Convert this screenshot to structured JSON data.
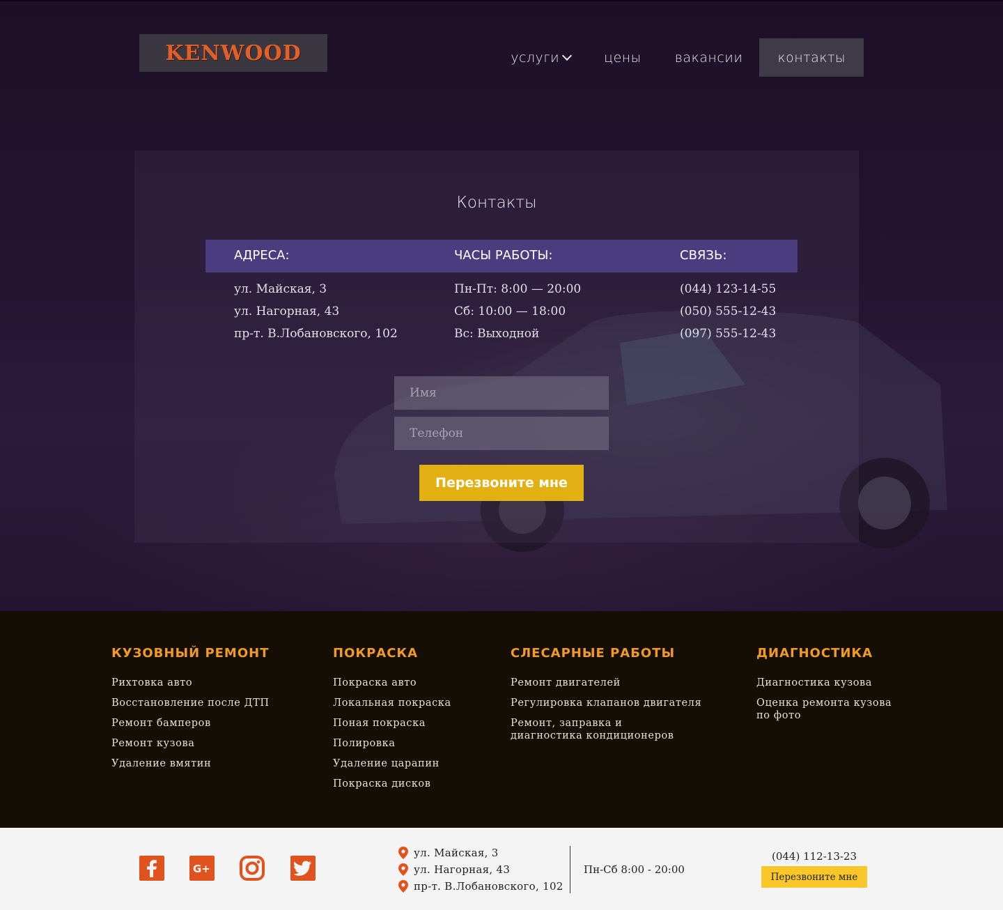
{
  "header": {
    "logo_text": "KENWOOD",
    "nav": [
      {
        "label": "услуги"
      },
      {
        "label": "цены"
      },
      {
        "label": "вакансии"
      },
      {
        "label": "контакты"
      }
    ]
  },
  "contacts": {
    "title": "Контакты",
    "addresses_header": "АДРЕСА:",
    "hours_header": "ЧАСЫ РАБОТЫ:",
    "contact_header": "СВЯЗЬ:",
    "addresses": [
      "ул. Майская, 3",
      "ул. Нагорная, 43",
      "пр-т. В.Лобановского, 102"
    ],
    "hours": [
      "Пн-Пт: 8:00 — 20:00",
      "Сб: 10:00 — 18:00",
      "Вс: Выходной"
    ],
    "phones": [
      "(044) 123-14-55",
      "(050) 555-12-43",
      "(097) 555-12-43"
    ],
    "name_placeholder": "Имя",
    "phone_placeholder": "Телефон",
    "callback_label": "Перезвоните мне"
  },
  "services": [
    {
      "title": "КУЗОВНЫЙ РЕМОНТ",
      "items": [
        "Рихтовка авто",
        "Восстановление после ДТП",
        "Ремонт бамперов",
        "Ремонт кузова",
        "Удаление вмятин"
      ]
    },
    {
      "title": "ПОКРАСКА",
      "items": [
        "Покраска авто",
        "Локальная покраска",
        "Поная покраска",
        "Полировка",
        "Удаление царапин",
        "Покраска дисков"
      ]
    },
    {
      "title": "СЛЕСАРНЫЕ РАБОТЫ",
      "items": [
        "Ремонт двигателей",
        "Регулировка клапанов двигателя",
        "Ремонт, заправка и диагностика кондиционеров"
      ]
    },
    {
      "title": "ДИАГНОСТИКА",
      "items": [
        "Диагностика кузова",
        "Оценка ремонта кузова по фото"
      ]
    }
  ],
  "footer": {
    "social_icons": [
      "facebook-icon",
      "google-plus-icon",
      "instagram-icon",
      "twitter-icon"
    ],
    "addresses": [
      "ул. Майская, 3",
      "ул. Нагорная, 43",
      "пр-т. В.Лобановского, 102"
    ],
    "hours": "Пн-Сб 8:00 - 20:00",
    "phone": "(044) 112-13-23",
    "callback_label": "Перезвоните мне"
  },
  "colors": {
    "accent_orange": "#f29a22",
    "cta_yellow": "#e2b012",
    "info_bar_purple": "#4b3c80",
    "social_orange": "#e0531f"
  }
}
